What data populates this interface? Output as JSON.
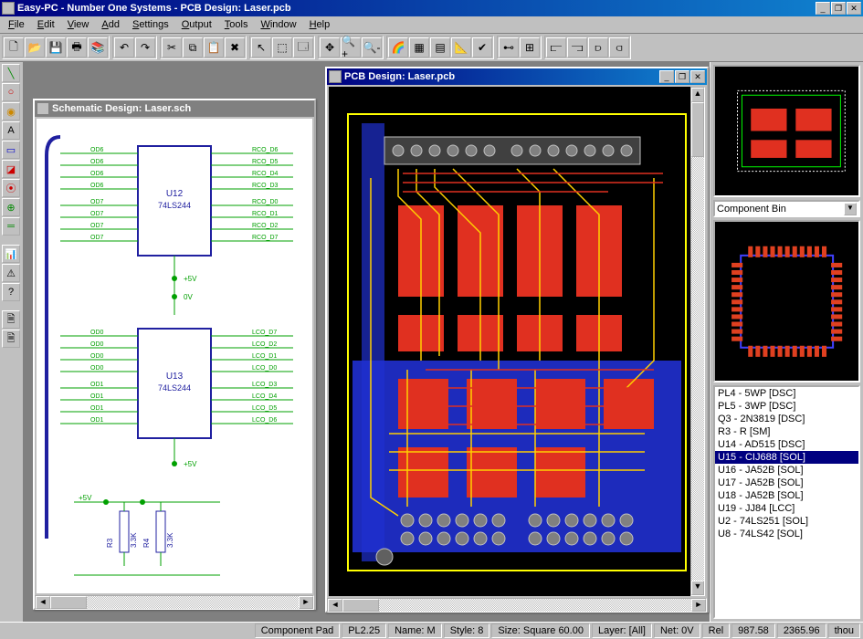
{
  "app": {
    "title": "Easy-PC - Number One Systems - PCB Design: Laser.pcb"
  },
  "menu": {
    "file": "File",
    "edit": "Edit",
    "view": "View",
    "add": "Add",
    "settings": "Settings",
    "output": "Output",
    "tools": "Tools",
    "window": "Window",
    "help": "Help"
  },
  "windows": {
    "schematic": {
      "title": "Schematic Design: Laser.sch"
    },
    "pcb": {
      "title": "PCB Design: Laser.pcb"
    }
  },
  "schematic": {
    "u12_ref": "U12",
    "u12_part": "74LS244",
    "u13_ref": "U13",
    "u13_part": "74LS244",
    "r3_ref": "R3",
    "r3_val": "3.3K",
    "r4_ref": "R4",
    "r4_val": "3.3K",
    "od_top": [
      "OD6",
      "OD6",
      "OD6",
      "OD6",
      "OD7",
      "OD7",
      "OD7",
      "OD7"
    ],
    "rco_top": [
      "RCO_D6",
      "RCO_D5",
      "RCO_D4",
      "RCO_D3",
      "RCO_D0",
      "RCO_D1",
      "RCO_D2",
      "RCO_D7"
    ],
    "od_bot": [
      "OD0",
      "OD0",
      "OD0",
      "OD0",
      "OD1",
      "OD1",
      "OD1",
      "OD1"
    ],
    "lco_bot": [
      "LCO_D7",
      "LCO_D2",
      "LCO_D1",
      "LCO_D0",
      "LCO_D3",
      "LCO_D4",
      "LCO_D5",
      "LCO_D6"
    ],
    "p5v": "+5V",
    "p0v": "0V",
    "p5v2": "+5V"
  },
  "rightpanel": {
    "combo_label": "Component Bin",
    "bin_items": [
      "PL4 - 5WP [DSC]",
      "PL5 - 3WP [DSC]",
      "Q3 - 2N3819 [DSC]",
      "R3 - R [SM]",
      "U14 - AD515 [DSC]",
      "U15 - CIJ688 [SOL]",
      "U16 - JA52B [SOL]",
      "U17 - JA52B [SOL]",
      "U18 - JA52B [SOL]",
      "U19 - JJ84 [LCC]",
      "U2 - 74LS251 [SOL]",
      "U8 - 74LS42 [SOL]"
    ],
    "bin_selected_index": 5
  },
  "status": {
    "s0": "Component Pad",
    "s1": "PL2.25",
    "s2": "Name: M",
    "s3": "Style: 8",
    "s4": "Size: Square 60.00",
    "s5": "Layer: [All]",
    "s6": "Net: 0V",
    "s7": "Rel",
    "s8": "987.58",
    "s9": "2365.96",
    "s10": "thou"
  }
}
